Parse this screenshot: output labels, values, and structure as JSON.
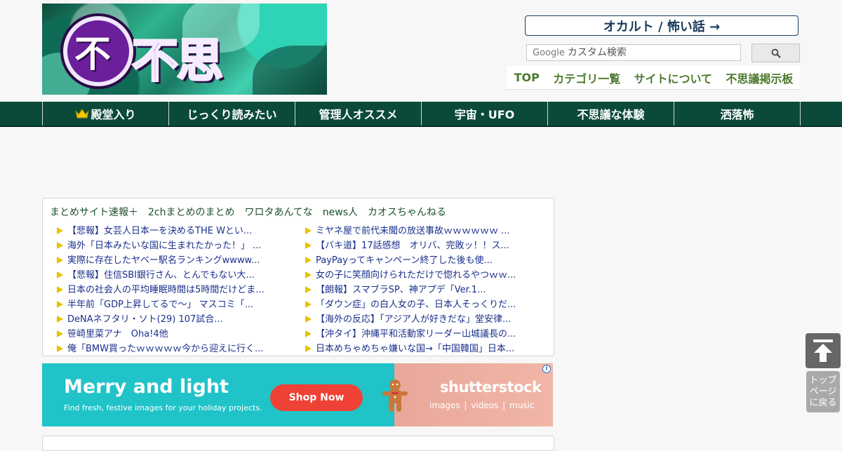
{
  "header": {
    "logo_text": "不思議.NET",
    "occult_link": "オカルト / 怖い話 →",
    "search": {
      "brand": "Google",
      "placeholder": "カスタム検索"
    },
    "nav": [
      "TOP",
      "カテゴリ一覧",
      "サイトについて",
      "不思議掲示板"
    ]
  },
  "categories": [
    "殿堂入り",
    "じっくり読みたい",
    "管理人オススメ",
    "宇宙・UFO",
    "不思議な体験",
    "洒落怖"
  ],
  "feed": {
    "sites": [
      "まとめサイト速報＋",
      "2chまとめのまとめ",
      "ワロタあんてな",
      "news人",
      "カオスちゃんねる"
    ],
    "left": [
      "【悲報】女芸人日本一を決めるTHE Wとい...",
      "海外「日本みたいな国に生まれたかった！」 ...",
      "実際に存在したヤベー駅名ランキングwwww...",
      "【悲報】住信SBI銀行さん、とんでもない大...",
      "日本の社会人の平均睡眠時間は5時間だけどま...",
      "半年前「GDP上昇してるで～」 マスコミ「...",
      "DeNAネフタリ・ソト(29) 107試合...",
      "笹崎里菜アナ　Oha!4他",
      "俺「BMW買ったｗｗｗｗｗ今から迎えに行く..."
    ],
    "right": [
      "ミヤネ屋で前代未聞の放送事故ｗｗｗｗｗｗ ...",
      "【バキ道】17話感想　オリバ、完敗ッ！！ス...",
      "PayPayってキャンペーン終了した後も使...",
      "女の子に笑顔向けられただけで惚れるやつｗｗ...",
      "【朗報】スマブラSP、神アプデ「Ver.1...",
      "「ダウン症」の白人女の子、日本人そっくりだ...",
      "【海外の反応】「アジア人が好きだな」堂安律...",
      "【沖タイ】沖縄平和活動家リーダー山城議長の...",
      "日本めちゃめちゃ嫌いな国→「中国韓国」日本..."
    ]
  },
  "ad": {
    "headline": "Merry and light",
    "subtext": "Find fresh, festive images for your holiday projects.",
    "cta": "Shop Now",
    "brand": "shutterstock",
    "links": "images  |  videos  |  music",
    "info": "i"
  },
  "back_to_top": {
    "label_lines": [
      "トップ",
      "ページ",
      "に戻る"
    ]
  },
  "colors": {
    "category_bar": "#0b4a3a",
    "nav_text": "#4d7a2e",
    "feed_link": "#1a2f8c",
    "ad_teal": "#20c3c8",
    "ad_cta": "#ef4135"
  }
}
